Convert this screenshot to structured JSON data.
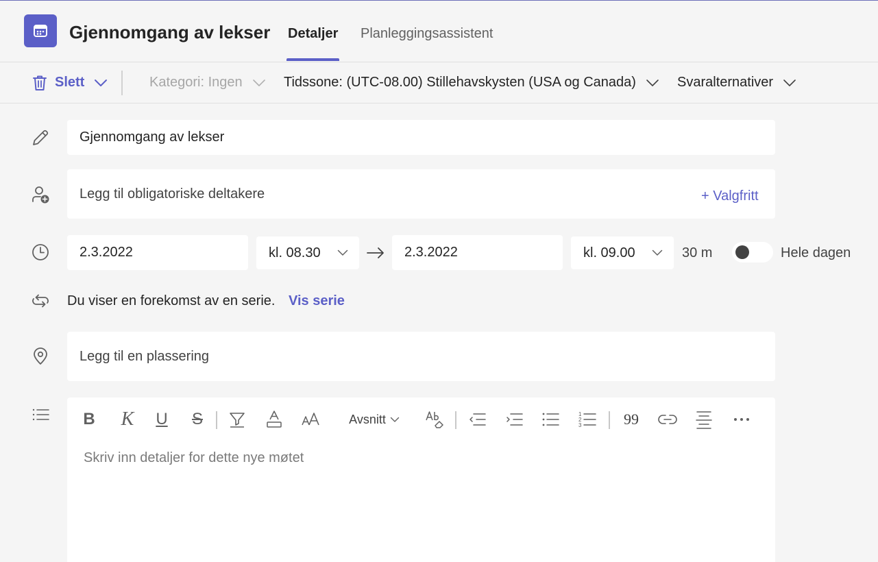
{
  "header": {
    "title": "Gjennomgang av lekser",
    "tabs": [
      {
        "label": "Detaljer",
        "active": true
      },
      {
        "label": "Planleggingsassistent",
        "active": false
      }
    ]
  },
  "toolbar": {
    "delete_label": "Slett",
    "category_label": "Kategori: Ingen",
    "timezone_label": "Tidssone: (UTC-08.00) Stillehavskysten (USA og Canada)",
    "response_label": "Svaralternativer"
  },
  "form": {
    "title_value": "Gjennomgang av lekser",
    "attendees_placeholder": "Legg til obligatoriske deltakere",
    "optional_label": "+ Valgfritt",
    "start_date": "2.3.2022",
    "start_time": "kl. 08.30",
    "end_date": "2.3.2022",
    "end_time": "kl. 09.00",
    "duration": "30 m",
    "all_day_label": "Hele dagen",
    "all_day_on": false,
    "series_text": "Du viser en forekomst av en serie.",
    "series_link": "Vis serie",
    "location_placeholder": "Legg til en plassering"
  },
  "editor": {
    "bold": "B",
    "italic": "K",
    "underline": "U",
    "strikethrough": "S",
    "paragraph_label": "Avsnitt",
    "quote": "99",
    "placeholder": "Skriv inn detaljer for dette nye møtet"
  },
  "colors": {
    "accent": "#5b5fc7",
    "background": "#f5f5f5",
    "field": "#ffffff",
    "muted_text": "#a6a6a6"
  },
  "icons": [
    "calendar-icon",
    "trash-icon",
    "chevron-down-icon",
    "pencil-icon",
    "person-add-icon",
    "clock-icon",
    "arrow-right-icon",
    "repeat-icon",
    "location-pin-icon",
    "list-details-icon"
  ]
}
